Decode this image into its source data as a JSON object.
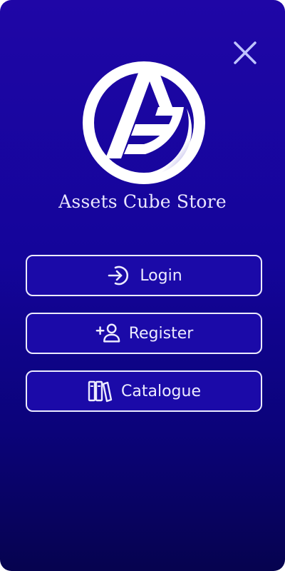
{
  "brand": {
    "name": "Assets Cube  Store"
  },
  "menu": {
    "login_label": "Login",
    "register_label": "Register",
    "catalogue_label": "Catalogue"
  },
  "icons": {
    "close": "close-icon",
    "login": "login-icon",
    "register": "add-user-icon",
    "catalogue": "books-icon",
    "logo": "assets-cube-logo"
  },
  "colors": {
    "background_top": "#1f06a6",
    "background_bottom": "#06034f",
    "button_fill": "#1b0aa8",
    "button_border": "#ecebff",
    "text": "#ecebff"
  }
}
